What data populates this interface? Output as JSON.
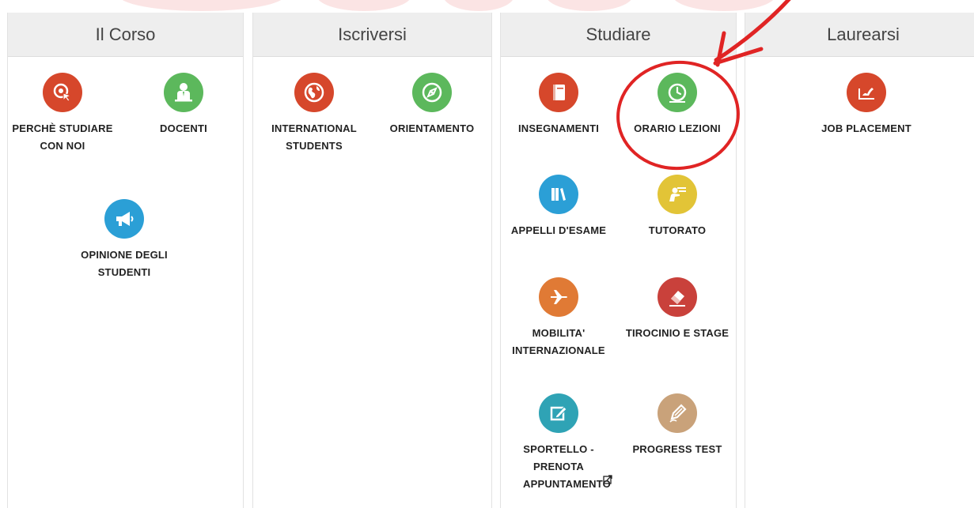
{
  "colors": {
    "header_bg": "#eeeeee",
    "annotation_red": "#e02424",
    "icon_red": "#d6472b",
    "icon_green": "#5cb85c",
    "icon_blue": "#2b9fd6",
    "icon_yellow": "#e2c437",
    "icon_orange": "#e07a35",
    "icon_darkred": "#c9413b",
    "icon_teal": "#2fa3b5",
    "icon_tan": "#c9a27a"
  },
  "columns": [
    {
      "title": "Il Corso",
      "tiles": [
        {
          "label": "PERCHÈ STUDIARE CON NOI",
          "icon": "cursor-target-icon",
          "color": "#d6472b"
        },
        {
          "label": "DOCENTI",
          "icon": "teacher-icon",
          "color": "#5cb85c"
        },
        {
          "label": "OPINIONE DEGLI STUDENTI",
          "icon": "megaphone-icon",
          "color": "#2b9fd6"
        }
      ]
    },
    {
      "title": "Iscriversi",
      "tiles": [
        {
          "label": "INTERNATIONAL STUDENTS",
          "icon": "globe-icon",
          "color": "#d6472b"
        },
        {
          "label": "ORIENTAMENTO",
          "icon": "compass-icon",
          "color": "#5cb85c"
        }
      ]
    },
    {
      "title": "Studiare",
      "tiles": [
        {
          "label": "INSEGNAMENTI",
          "icon": "book-icon",
          "color": "#d6472b"
        },
        {
          "label": "ORARIO LEZIONI",
          "icon": "clock-icon",
          "color": "#5cb85c"
        },
        {
          "label": "APPELLI D'ESAME",
          "icon": "books-icon",
          "color": "#2b9fd6"
        },
        {
          "label": "TUTORATO",
          "icon": "tutor-icon",
          "color": "#e2c437"
        },
        {
          "label": "MOBILITA' INTERNAZIONALE",
          "icon": "airplane-icon",
          "color": "#e07a35"
        },
        {
          "label": "TIROCINIO E STAGE",
          "icon": "eraser-icon",
          "color": "#c9413b"
        },
        {
          "label": "SPORTELLO - PRENOTA APPUNTAMENTO",
          "icon": "edit-icon",
          "color": "#2fa3b5",
          "external": true
        },
        {
          "label": "PROGRESS TEST",
          "icon": "pen-icon",
          "color": "#c9a27a"
        }
      ]
    },
    {
      "title": "Laurearsi",
      "tiles": [
        {
          "label": "JOB PLACEMENT",
          "icon": "signature-icon",
          "color": "#d6472b"
        }
      ]
    }
  ]
}
